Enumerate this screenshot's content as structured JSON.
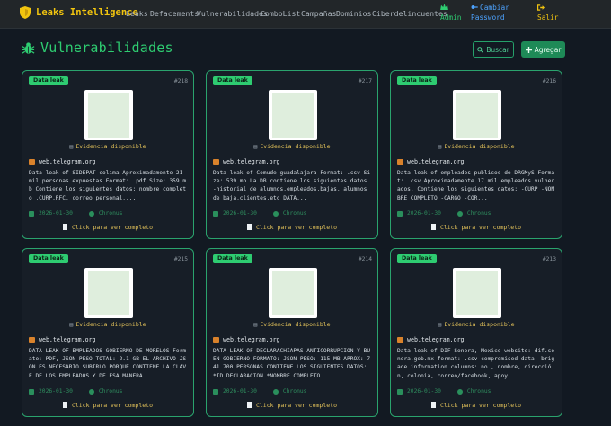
{
  "nav": {
    "brand": "Leaks Intelligence",
    "links": [
      "Leaks",
      "Defacements",
      "Vulnerabilidades",
      "ComboList",
      "Campañas",
      "Dominios",
      "Ciberdelincuentes"
    ],
    "admin": "Admin",
    "change_password_1": "Cambiar",
    "change_password_2": "Password",
    "logout": "Salir"
  },
  "header": {
    "title": "Vulnerabilidades",
    "search_label": "Buscar",
    "add_label": "Agregar"
  },
  "cards": [
    {
      "badge": "Data leak",
      "num": "#218",
      "evidence": "Evidencia disponible",
      "source": "web.telegram.org",
      "desc": "Data leak of SIDEPAT colima Aproximadamente 21 mil personas expuestas Format: .pdf Size: 359 mb Contiene los siguientes datos: nombre completo ,CURP,RFC, correo personal,...",
      "date": "2026-01-30",
      "user": "Chronus",
      "click": "Click para ver completo"
    },
    {
      "badge": "Data leak",
      "num": "#217",
      "evidence": "Evidencia disponible",
      "source": "web.telegram.org",
      "desc": "Data leak of Comude guadalajara Format: .csv Size: 539 mb La DB contiene los siguientes datos -historial de alumnos,empleados,bajas, alumnos de baja,clientes,etc DATA...",
      "date": "2026-01-30",
      "user": "Chronus",
      "click": "Click para ver completo"
    },
    {
      "badge": "Data leak",
      "num": "#216",
      "evidence": "Evidencia disponible",
      "source": "web.telegram.org",
      "desc": "Data leak of empleados publicos de DRGMyS Format: .csv Aproximadamente 17 mil empleados vulnerados. Contiene los siguientes datos: -CURP -NOMBRE COMPLETO -CARGO -COR...",
      "date": "2026-01-30",
      "user": "Chronus",
      "click": "Click para ver completo"
    },
    {
      "badge": "Data leak",
      "num": "#215",
      "evidence": "Evidencia disponible",
      "source": "web.telegram.org",
      "desc": "DATA LEAK OF EMPLEADOS GOBIERNO DE MORELOS Formato: PDF, JSON PESO TOTAL: 2.1 GB EL ARCHIVO JSON ES NECESARIO SUBIRLO PORQUE CONTIENE LA CLAVE DE LOS EMPLEADOS Y DE ESA MANERA...",
      "date": "2026-01-30",
      "user": "Chronus",
      "click": "Click para ver completo"
    },
    {
      "badge": "Data leak",
      "num": "#214",
      "evidence": "Evidencia disponible",
      "source": "web.telegram.org",
      "desc": "DATA LEAK OF DECLARACHIAPAS ANTICORRUPCION Y BUEN GOBIERNO FORMATO: JSON PESO: 115 MB APROX: 741.700 PERSONAS CONTIENE LOS SIGUIENTES DATOS: *ID DECLARACION *NOMBRE COMPLETO ...",
      "date": "2026-01-30",
      "user": "Chronus",
      "click": "Click para ver completo"
    },
    {
      "badge": "Data leak",
      "num": "#213",
      "evidence": "Evidencia disponible",
      "source": "web.telegram.org",
      "desc": "Data leak of DIF Sonora, Mexico website: dif.sonora.gob.mx format: .csv compromised data: brigade information columns: no., nombre, dirección, colonia, correo/facebook, apoy...",
      "date": "2026-01-30",
      "user": "Chronus",
      "click": "Click para ver completo"
    }
  ],
  "colors": {
    "accent": "#2ecc71",
    "brand": "#f1c40f",
    "card_border": "#2aa36d",
    "background": "#121922"
  }
}
